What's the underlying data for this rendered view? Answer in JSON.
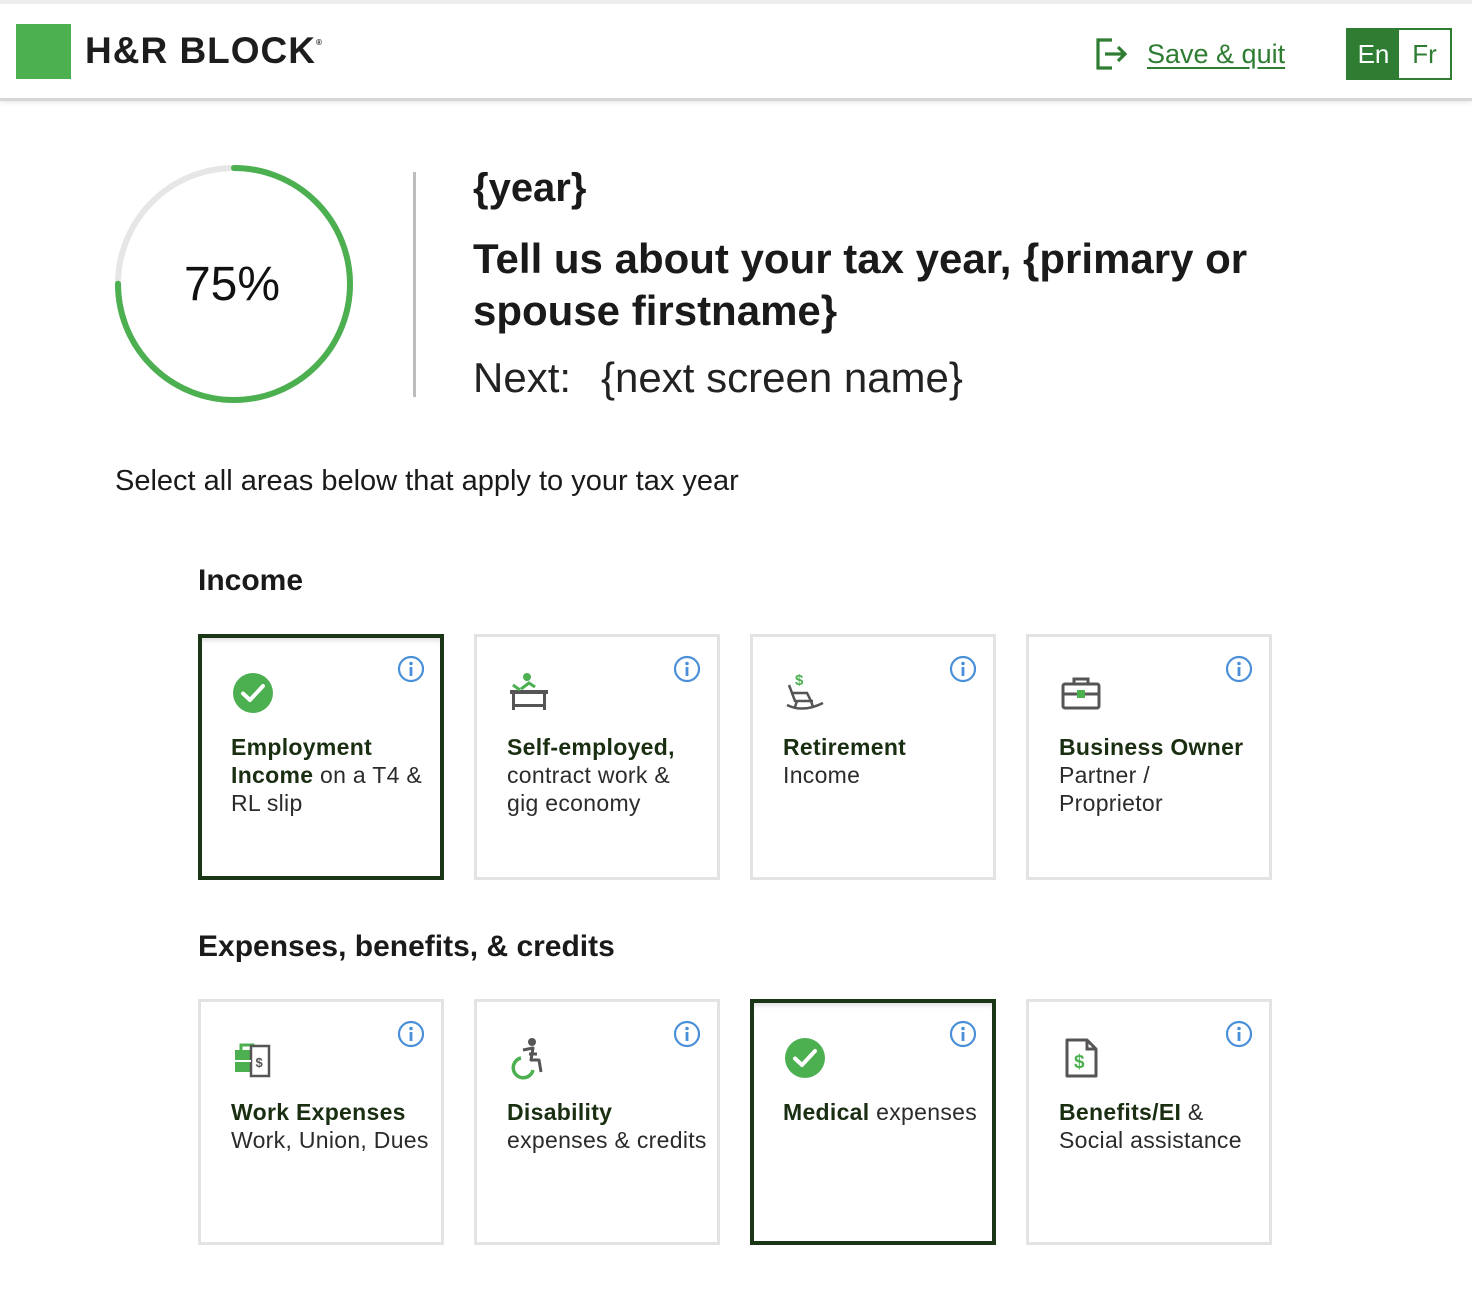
{
  "header": {
    "brand": "H&R BLOCK",
    "save_quit": "Save & quit",
    "lang_en": "En",
    "lang_fr": "Fr"
  },
  "progress": {
    "percent_label": "75%",
    "value": 0.75
  },
  "intro": {
    "year": "{year}",
    "headline": "Tell us about your tax year, {primary or spouse firstname}",
    "next_label": "Next:",
    "next_value": "{next screen name}",
    "instruction": "Select all areas below that apply to your tax year"
  },
  "sections": [
    {
      "title": "Income",
      "cards": [
        {
          "title": "Employment Income",
          "desc": " on a T4 & RL slip",
          "selected": true,
          "icon": "check-circle-icon"
        },
        {
          "title": "Self-employed,",
          "desc": " contract work & gig economy",
          "selected": false,
          "icon": "desk-worker-icon"
        },
        {
          "title": "Retirement",
          "desc": " Income",
          "selected": false,
          "icon": "rocking-chair-icon"
        },
        {
          "title": "Business Owner",
          "desc": " Partner / Proprietor",
          "selected": false,
          "icon": "briefcase-icon"
        }
      ]
    },
    {
      "title": "Expenses, benefits, & credits",
      "cards": [
        {
          "title": "Work Expenses",
          "desc": " Work, Union, Dues",
          "selected": false,
          "icon": "work-expenses-icon"
        },
        {
          "title": "Disability",
          "desc": " expenses & credits",
          "selected": false,
          "icon": "accessibility-icon"
        },
        {
          "title": "Medical",
          "desc": " expenses",
          "selected": true,
          "icon": "check-circle-icon"
        },
        {
          "title": "Benefits/EI",
          "desc": " & Social assistance",
          "selected": false,
          "icon": "benefits-document-icon"
        }
      ]
    }
  ],
  "colors": {
    "brand_green": "#4caf50",
    "dark_green": "#2e7d32",
    "selected_border": "#1b3617",
    "info_blue": "#4a90d9"
  }
}
